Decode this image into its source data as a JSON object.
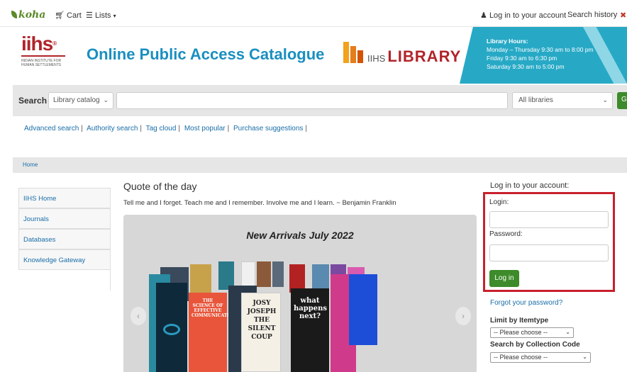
{
  "topbar": {
    "logo": "koha",
    "cart": "Cart",
    "lists": "Lists",
    "login": "Log in to your account",
    "history": "Search history"
  },
  "header": {
    "logo_word": "iihs",
    "logo_reg": "®",
    "logo_sub": "INDIAN INSTITUTE FOR HUMAN SETTLEMENTS",
    "title": "Online Public Access Catalogue",
    "library_prefix": "IIHS",
    "library_name": "LIBRARY",
    "hours_title": "Library Hours:",
    "hours_line1": "Monday – Thursday 9:30 am to 8:00 pm",
    "hours_line2": "Friday 9:30 am to 6:30 pm",
    "hours_line3": "Saturday 9:30 am to 5:00 pm"
  },
  "search": {
    "label": "Search",
    "scope": "Library catalog",
    "query": "",
    "library": "All libraries",
    "go": "Go"
  },
  "links": [
    "Advanced search",
    "Authority search",
    "Tag cloud",
    "Most popular",
    "Purchase suggestions"
  ],
  "breadcrumb": "Home",
  "leftnav": [
    "IIHS Home",
    "Journals",
    "Databases",
    "Knowledge Gateway"
  ],
  "quote": {
    "title": "Quote of the day",
    "text": "Tell me and I forget. Teach me and I remember. Involve me and I learn. ~ Benjamin Franklin"
  },
  "carousel": {
    "title": "New Arrivals July 2022",
    "books": [
      {
        "label": "THE SCIENCE OF EFFECTIVE COMMUNICATION"
      },
      {
        "label": "JOSY JOSEPH THE SILENT COUP"
      },
      {
        "label": "what happens next?"
      }
    ]
  },
  "login": {
    "heading": "Log in to your account:",
    "login_label": "Login:",
    "password_label": "Password:",
    "button": "Log in",
    "forgot": "Forgot your password?"
  },
  "limits": {
    "itemtype_heading": "Limit by Itemtype",
    "itemtype_value": "-- Please choose --",
    "collection_heading": "Search by Collection Code",
    "collection_value": "-- Please choose --"
  },
  "colors": {
    "brand_red": "#b1242a",
    "accent_green": "#3d8b2a",
    "title_blue": "#1a8fc0",
    "hours_teal": "#27a9c6",
    "highlight_red": "#c8202b"
  }
}
